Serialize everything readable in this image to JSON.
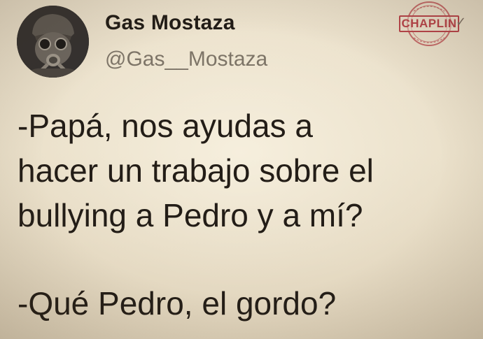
{
  "profile": {
    "display_name": "Gas Mostaza",
    "handle": "@Gas__Mostaza",
    "avatar_icon": "gas-mask-avatar"
  },
  "stamp": {
    "label": "CHAPLIN",
    "color": "#b9434a"
  },
  "tweet": {
    "lines": [
      "-Papá, nos ayudas a",
      "hacer un trabajo sobre el",
      "bullying a Pedro y a mí?",
      "-Qué Pedro, el gordo?"
    ]
  },
  "colors": {
    "background": "#ebe1cb",
    "text": "#231d17",
    "handle": "#7d7467"
  }
}
